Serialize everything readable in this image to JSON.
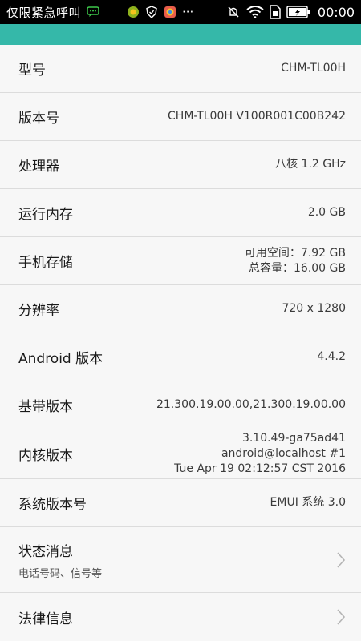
{
  "status_bar": {
    "carrier": "仅限紧急呼叫",
    "time": "00:00",
    "icons": [
      "chat-icon",
      "app-icon",
      "shield-icon",
      "browser-icon",
      "more-icon",
      "mute-icon",
      "wifi-icon",
      "sim-icon",
      "battery-icon"
    ],
    "more_glyph": "···"
  },
  "colors": {
    "accent": "#35b8a9",
    "status_bar": "#000000",
    "background": "#f7f7f7"
  },
  "rows": [
    {
      "label": "型号",
      "value": "CHM-TL00H"
    },
    {
      "label": "版本号",
      "value": "CHM-TL00H V100R001C00B242"
    },
    {
      "label": "处理器",
      "value": "八核 1.2 GHz"
    },
    {
      "label": "运行内存",
      "value": "2.0 GB"
    },
    {
      "label": "手机存储",
      "value_lines": [
        "可用空间：7.92  GB",
        "总容量：16.00  GB"
      ]
    },
    {
      "label": "分辨率",
      "value": "720 x 1280"
    },
    {
      "label": "Android 版本",
      "value": "4.4.2"
    },
    {
      "label": "基带版本",
      "value": "21.300.19.00.00,21.300.19.00.00"
    },
    {
      "label": "内核版本",
      "value_lines": [
        "3.10.49-ga75ad41",
        "android@localhost #1",
        "Tue Apr 19 02:12:57 CST 2016"
      ]
    },
    {
      "label": "系统版本号",
      "value": "EMUI 系统 3.0"
    },
    {
      "label": "状态消息",
      "sublabel": "电话号码、信号等"
    },
    {
      "label": "法律信息"
    }
  ]
}
